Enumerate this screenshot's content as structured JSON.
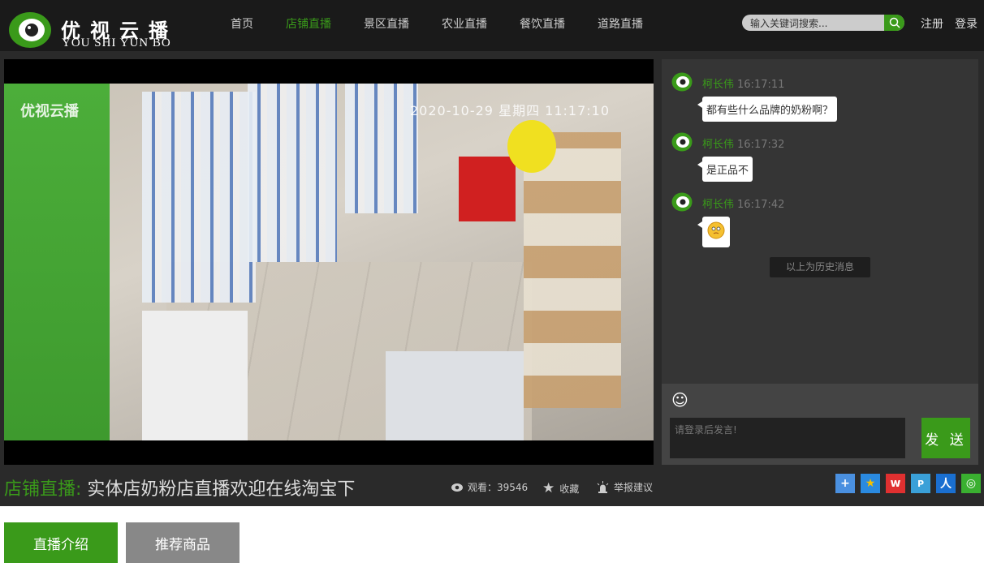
{
  "header": {
    "logo_cn": "优视云播",
    "logo_en": "YOU SHI YUN BO",
    "nav": [
      {
        "label": "首页",
        "active": false
      },
      {
        "label": "店铺直播",
        "active": true
      },
      {
        "label": "景区直播",
        "active": false
      },
      {
        "label": "农业直播",
        "active": false
      },
      {
        "label": "餐饮直播",
        "active": false
      },
      {
        "label": "道路直播",
        "active": false
      }
    ],
    "search_placeholder": "输入关键词搜索...",
    "register": "注册",
    "login": "登录"
  },
  "video": {
    "overlay_logo": "优视云播",
    "overlay_timestamp": "2020-10-29 星期四 11:17:10"
  },
  "chat": {
    "messages": [
      {
        "user": "柯长伟",
        "time": "16:17:11",
        "text": "都有些什么品牌的奶粉啊？"
      },
      {
        "user": "柯长伟",
        "time": "16:17:32",
        "text": "是正品不"
      },
      {
        "user": "柯长伟",
        "time": "16:17:42",
        "text": "",
        "emoji": "shy-face-emoji"
      }
    ],
    "history_label": "以上为历史消息",
    "input_placeholder": "请登录后发言!",
    "send_label": "发 送"
  },
  "info": {
    "category": "店铺直播:",
    "title": "实体店奶粉店直播欢迎在线淘宝下",
    "views": "观看：39546",
    "favorite": "收藏",
    "report": "举报建议",
    "share_icons": [
      "share-more-icon",
      "qzone-icon",
      "weibo-icon",
      "tencent-weibo-icon",
      "renren-icon",
      "wechat-icon"
    ]
  },
  "tabs": [
    {
      "label": "直播介绍",
      "active": true
    },
    {
      "label": "推荐商品",
      "active": false
    }
  ],
  "colors": {
    "accent": "#3a9a1a",
    "header_bg": "#1a1a1a",
    "main_bg": "#2a2a2a"
  }
}
